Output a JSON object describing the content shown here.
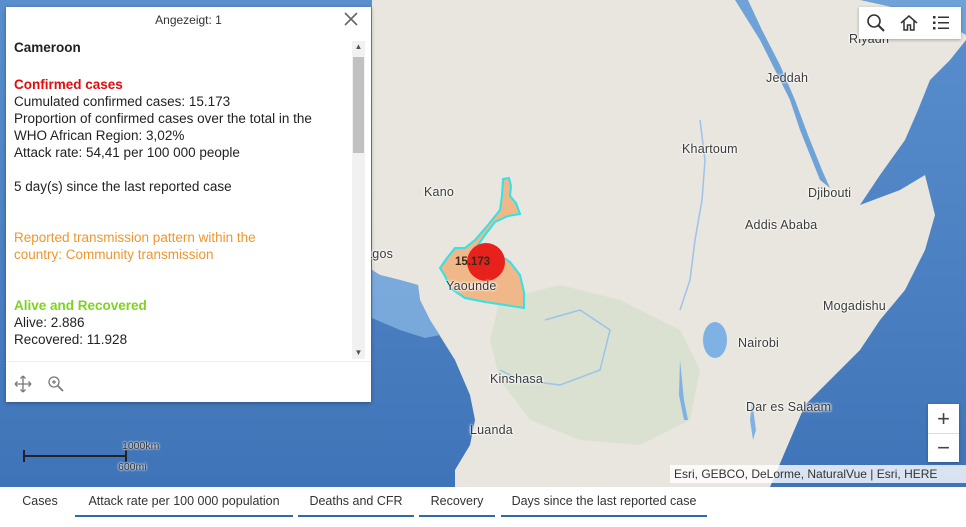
{
  "popup": {
    "header": "Angezeigt: 1",
    "country": "Cameroon",
    "confirmed_heading": "Confirmed cases",
    "cumulated": "Cumulated confirmed cases: 15.173",
    "proportion_line1": "Proportion of confirmed cases over the total in the",
    "proportion_line2": "WHO African Region: 3,02%",
    "attack_rate": "Attack rate: 54,41 per 100 000 people",
    "days_since": "5  day(s) since the last reported case",
    "transmission_line1": "Reported transmission pattern within the",
    "transmission_line2": "country: Community transmission",
    "alive_heading": "Alive and Recovered",
    "alive": "Alive: 2.886",
    "recovered": "Recovered: 11.928",
    "footer_icons": [
      "pan-icon",
      "zoom-to-icon"
    ]
  },
  "map": {
    "places": {
      "riyadh": "Riyadh",
      "jeddah": "Jeddah",
      "khartoum": "Khartoum",
      "kano": "Kano",
      "djibouti": "Djibouti",
      "addis_ababa": "Addis Ababa",
      "lagos": "Lagos",
      "yaounde": "Yaounde",
      "mogadishu": "Mogadishu",
      "nairobi": "Nairobi",
      "kinshasa": "Kinshasa",
      "dar_es_salaam": "Dar es Salaam",
      "luanda": "Luanda"
    },
    "marker_value": "15.173",
    "scale": {
      "km": "1000km",
      "mi": "600mi"
    },
    "attribution": "Esri, GEBCO, DeLorme, NaturalVue | Esri, HERE",
    "zoom_in": "+",
    "zoom_out": "−",
    "colors": {
      "ocean": "#4f86c6",
      "land": "#e9e7df",
      "country_fill": "#f0b889",
      "country_outline": "#2fe3e6",
      "marker": "#e8211c"
    }
  },
  "toolbar": {
    "icons": [
      "search-icon",
      "home-icon",
      "legend-list-icon"
    ]
  },
  "tabs": [
    "Cases",
    "Attack rate per 100 000 population",
    "Deaths and CFR",
    "Recovery",
    "Days since the last reported case"
  ]
}
